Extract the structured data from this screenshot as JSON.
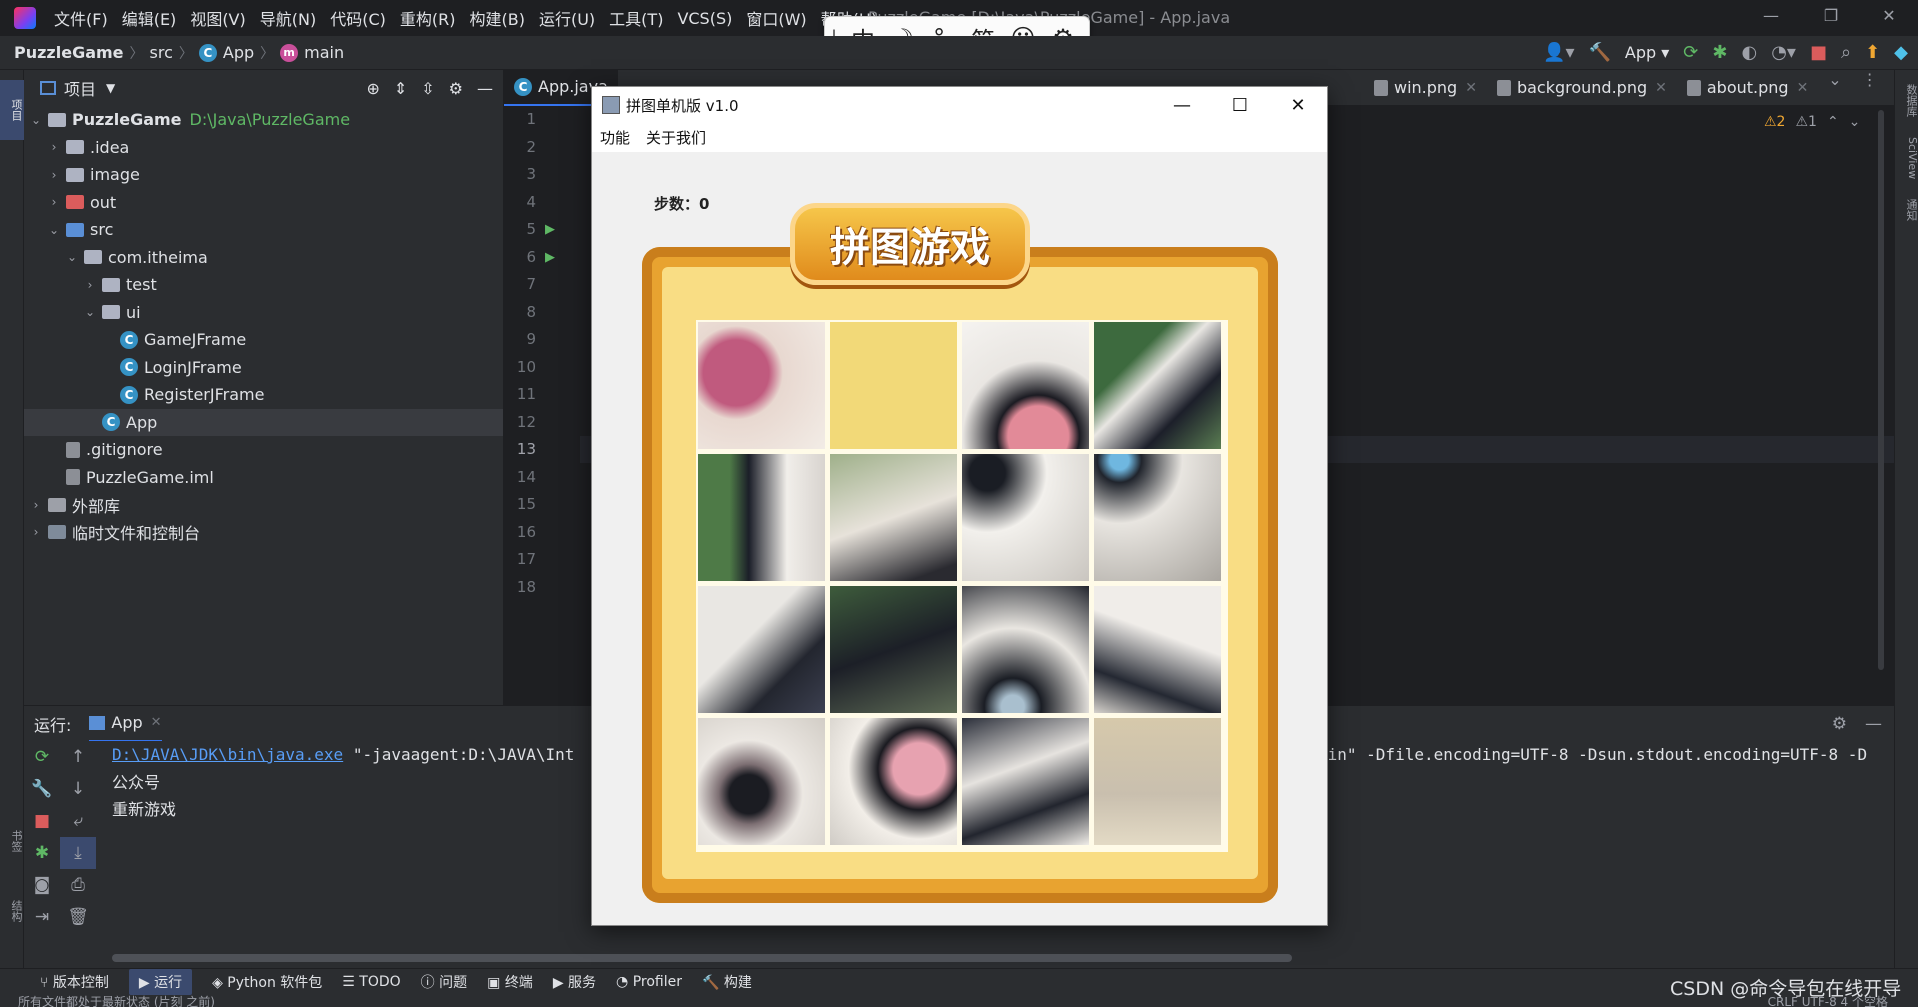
{
  "menubar": {
    "items": [
      "文件(F)",
      "编辑(E)",
      "视图(V)",
      "导航(N)",
      "代码(C)",
      "重构(R)",
      "构建(B)",
      "运行(U)",
      "工具(T)",
      "VCS(S)",
      "窗口(W)",
      "帮助(H)"
    ],
    "project_title": "PuzzleGame [D:\\Java\\PuzzleGame] - App.java"
  },
  "ime": {
    "items": [
      "中",
      "☽",
      "°,",
      "简",
      "☺",
      "⚙"
    ]
  },
  "nav": {
    "crumbs": [
      "PuzzleGame",
      "src",
      "App",
      "main"
    ],
    "run_config": "App"
  },
  "project_panel": {
    "title": "项目",
    "tree": [
      {
        "label": "PuzzleGame",
        "extra": "D:\\Java\\PuzzleGame",
        "depth": 0,
        "arrow": "v",
        "icon": "folder"
      },
      {
        "label": ".idea",
        "depth": 1,
        "arrow": ">",
        "icon": "folder"
      },
      {
        "label": "image",
        "depth": 1,
        "arrow": ">",
        "icon": "folder"
      },
      {
        "label": "out",
        "depth": 1,
        "arrow": ">",
        "icon": "folder-red"
      },
      {
        "label": "src",
        "depth": 1,
        "arrow": "v",
        "icon": "folder-blue"
      },
      {
        "label": "com.itheima",
        "depth": 2,
        "arrow": "v",
        "icon": "package"
      },
      {
        "label": "test",
        "depth": 3,
        "arrow": ">",
        "icon": "package"
      },
      {
        "label": "ui",
        "depth": 3,
        "arrow": "v",
        "icon": "package"
      },
      {
        "label": "GameJFrame",
        "depth": 4,
        "arrow": "",
        "icon": "class"
      },
      {
        "label": "LoginJFrame",
        "depth": 4,
        "arrow": "",
        "icon": "class"
      },
      {
        "label": "RegisterJFrame",
        "depth": 4,
        "arrow": "",
        "icon": "class"
      },
      {
        "label": "App",
        "depth": 3,
        "arrow": "",
        "icon": "class",
        "selected": true
      },
      {
        "label": ".gitignore",
        "depth": 1,
        "arrow": "",
        "icon": "file"
      },
      {
        "label": "PuzzleGame.iml",
        "depth": 1,
        "arrow": "",
        "icon": "file"
      },
      {
        "label": "外部库",
        "depth": 0,
        "arrow": ">",
        "icon": "library"
      },
      {
        "label": "临时文件和控制台",
        "depth": 0,
        "arrow": ">",
        "icon": "scratch"
      }
    ]
  },
  "tabs": [
    {
      "label": "App.java",
      "active": true
    },
    {
      "label": "win.png"
    },
    {
      "label": "background.png"
    },
    {
      "label": "about.png"
    }
  ],
  "editor": {
    "line_numbers": [
      "1",
      "2",
      "3",
      "4",
      "5",
      "6",
      "7",
      "8",
      "9",
      "10",
      "11",
      "12",
      "13",
      "14",
      "15",
      "16",
      "17",
      "18"
    ],
    "current_line": "13",
    "warnings": "⚠2",
    "weak_warnings": "⚠1"
  },
  "run_panel": {
    "label": "运行:",
    "tab": "App",
    "console": [
      {
        "prefix": "D:\\JAVA\\JDK\\bin\\java.exe",
        "rest": " \"-javaagent:D:\\JAVA\\Int",
        "tail": "bin\" -Dfile.encoding=UTF-8 -Dsun.stdout.encoding=UTF-8 -D"
      },
      {
        "prefix": "",
        "rest": "公众号",
        "tail": ""
      },
      {
        "prefix": "",
        "rest": "重新游戏",
        "tail": ""
      }
    ]
  },
  "statusbar": {
    "items": [
      "版本控制",
      "运行",
      "Python 软件包",
      "TODO",
      "问题",
      "终端",
      "服务",
      "Profiler",
      "构建"
    ],
    "active": "运行",
    "bottom_text": "所有文件都处于最新状态 (片刻 之前)",
    "encoding": "CRLF  UTF-8  4 个空格"
  },
  "watermark": "CSDN @命令导包在线开导",
  "game_window": {
    "title": "拼图单机版 v1.0",
    "menu": [
      "功能",
      "关于我们"
    ],
    "steps_label": "步数：",
    "steps_value": "0",
    "banner": "拼图游戏",
    "tiles": [
      [
        "tongue",
        "empty",
        "nose",
        "eye-right"
      ],
      [
        "fur-left",
        "whisker-light",
        "eye-center",
        "eye-blue"
      ],
      [
        "fur-dark",
        "whisker-dark",
        "cheek",
        "fur-mid"
      ],
      [
        "mouth-left",
        "teeth",
        "chin",
        "blur"
      ]
    ]
  }
}
